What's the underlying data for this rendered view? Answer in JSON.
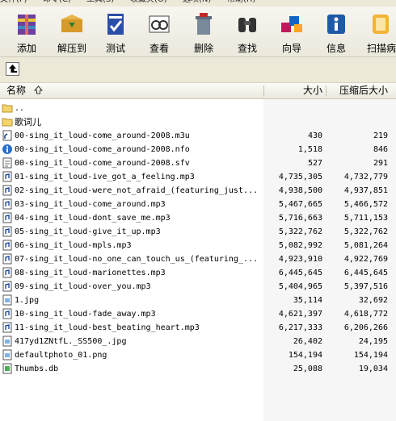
{
  "menu": [
    "文件(F)",
    "命令(C)",
    "工具(S)",
    "收藏夹(O)",
    "选项(N)",
    "帮助(H)"
  ],
  "toolbar": [
    {
      "label": "添加",
      "icon": "add-archive-icon"
    },
    {
      "label": "解压到",
      "icon": "extract-to-icon"
    },
    {
      "label": "测试",
      "icon": "test-icon"
    },
    {
      "label": "查看",
      "icon": "view-icon"
    },
    {
      "label": "删除",
      "icon": "delete-icon"
    },
    {
      "label": "查找",
      "icon": "find-icon"
    },
    {
      "label": "向导",
      "icon": "wizard-icon"
    },
    {
      "label": "信息",
      "icon": "info-icon"
    },
    {
      "label": "扫描病",
      "icon": "virus-scan-icon"
    }
  ],
  "columns": {
    "name": "名称",
    "size": "大小",
    "packed": "压缩后大小"
  },
  "files": [
    {
      "name": "..",
      "size": "",
      "packed": "",
      "type": "folder-up"
    },
    {
      "name": "歌词儿",
      "size": "",
      "packed": "",
      "type": "folder"
    },
    {
      "name": "00-sing_it_loud-come_around-2008.m3u",
      "size": "430",
      "packed": "219",
      "type": "text"
    },
    {
      "name": "00-sing_it_loud-come_around-2008.nfo",
      "size": "1,518",
      "packed": "846",
      "type": "nfo"
    },
    {
      "name": "00-sing_it_loud-come_around-2008.sfv",
      "size": "527",
      "packed": "291",
      "type": "sfv"
    },
    {
      "name": "01-sing_it_loud-ive_got_a_feeling.mp3",
      "size": "4,735,305",
      "packed": "4,732,779",
      "type": "mp3"
    },
    {
      "name": "02-sing_it_loud-were_not_afraid_(featuring_just...",
      "size": "4,938,500",
      "packed": "4,937,851",
      "type": "mp3"
    },
    {
      "name": "03-sing_it_loud-come_around.mp3",
      "size": "5,467,665",
      "packed": "5,466,572",
      "type": "mp3"
    },
    {
      "name": "04-sing_it_loud-dont_save_me.mp3",
      "size": "5,716,663",
      "packed": "5,711,153",
      "type": "mp3"
    },
    {
      "name": "05-sing_it_loud-give_it_up.mp3",
      "size": "5,322,762",
      "packed": "5,322,762",
      "type": "mp3"
    },
    {
      "name": "06-sing_it_loud-mpls.mp3",
      "size": "5,082,992",
      "packed": "5,081,264",
      "type": "mp3"
    },
    {
      "name": "07-sing_it_loud-no_one_can_touch_us_(featuring_...",
      "size": "4,923,910",
      "packed": "4,922,769",
      "type": "mp3"
    },
    {
      "name": "08-sing_it_loud-marionettes.mp3",
      "size": "6,445,645",
      "packed": "6,445,645",
      "type": "mp3"
    },
    {
      "name": "09-sing_it_loud-over_you.mp3",
      "size": "5,404,965",
      "packed": "5,397,516",
      "type": "mp3"
    },
    {
      "name": "1.jpg",
      "size": "35,114",
      "packed": "32,692",
      "type": "image"
    },
    {
      "name": "10-sing_it_loud-fade_away.mp3",
      "size": "4,621,397",
      "packed": "4,618,772",
      "type": "mp3"
    },
    {
      "name": "11-sing_it_loud-best_beating_heart.mp3",
      "size": "6,217,333",
      "packed": "6,206,266",
      "type": "mp3"
    },
    {
      "name": "417yd1ZNtfL._SS500_.jpg",
      "size": "26,402",
      "packed": "24,195",
      "type": "image"
    },
    {
      "name": "defaultphoto_01.png",
      "size": "154,194",
      "packed": "154,194",
      "type": "image"
    },
    {
      "name": "Thumbs.db",
      "size": "25,088",
      "packed": "19,034",
      "type": "db"
    }
  ]
}
